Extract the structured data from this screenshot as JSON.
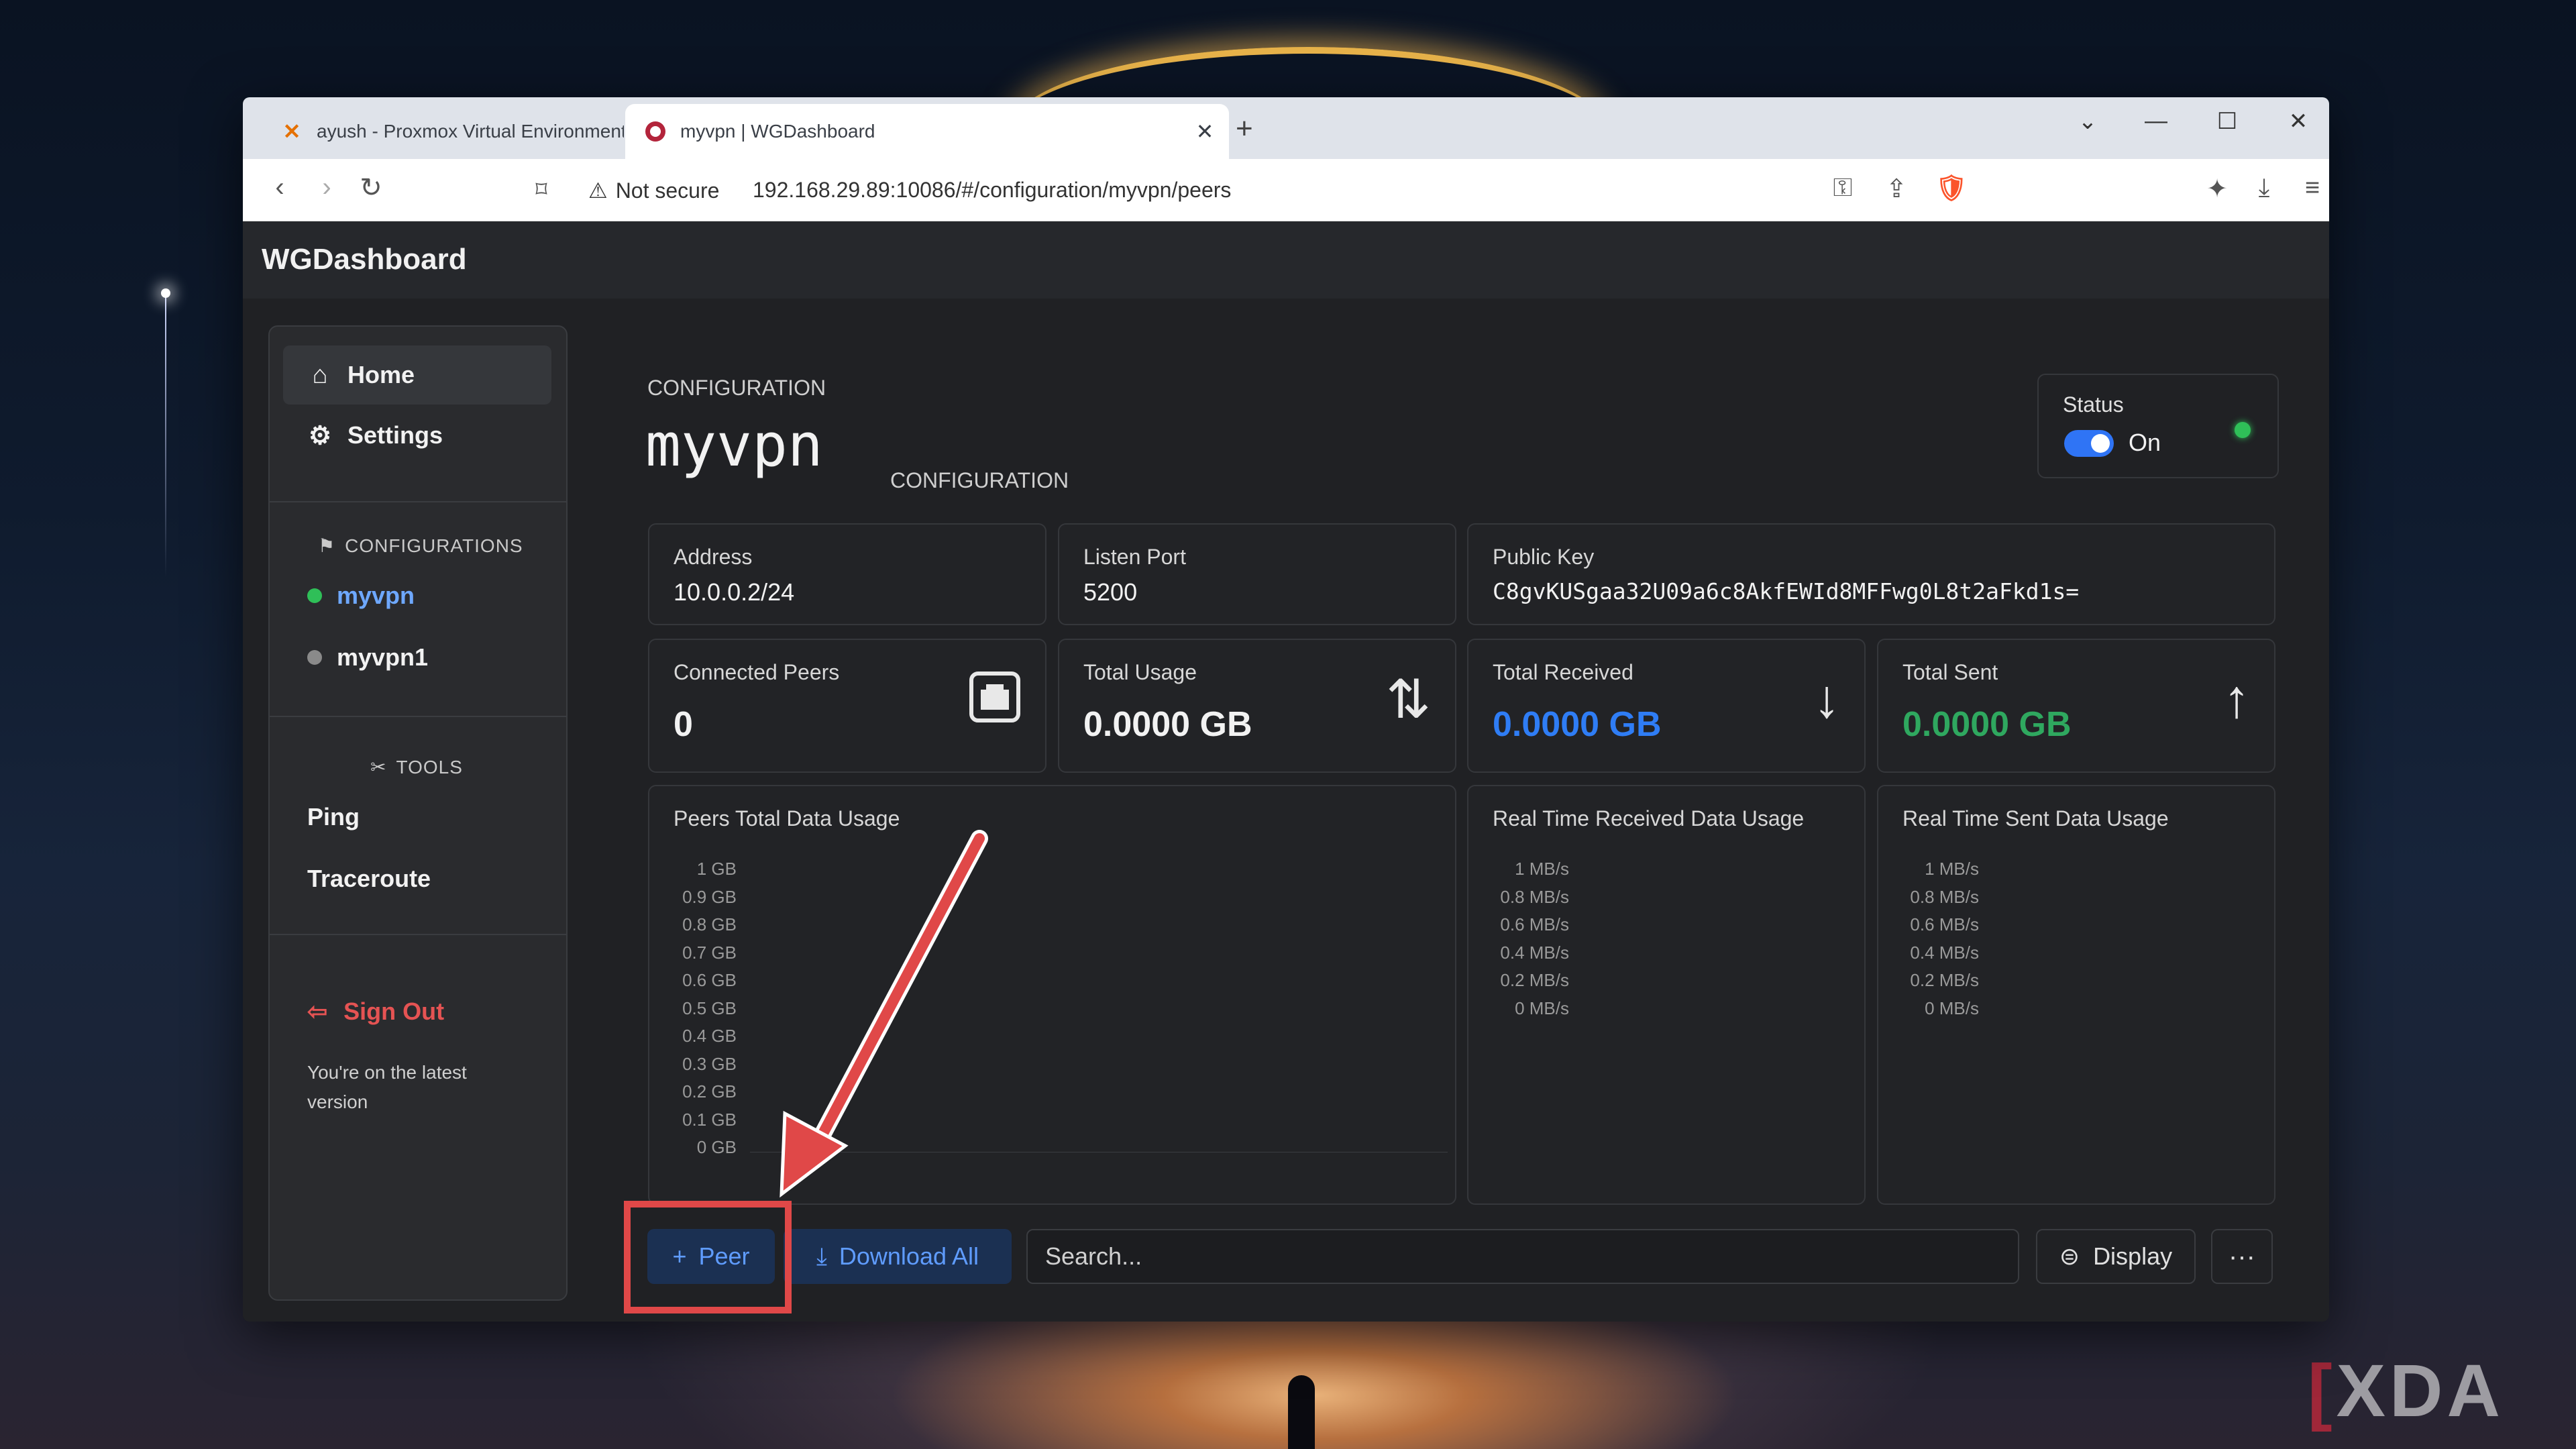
{
  "browser": {
    "tabs": [
      {
        "title": "ayush - Proxmox Virtual Environment",
        "active": false,
        "icon": "proxmox-icon"
      },
      {
        "title": "myvpn | WGDashboard",
        "active": true,
        "icon": "wgdashboard-icon"
      }
    ],
    "security_label": "Not secure",
    "url": "192.168.29.89:10086/#/configuration/myvpn/peers"
  },
  "app": {
    "title": "WGDashboard"
  },
  "sidebar": {
    "nav": [
      {
        "label": "Home",
        "icon": "home-icon"
      },
      {
        "label": "Settings",
        "icon": "gear-icon"
      }
    ],
    "configurations_heading": "CONFIGURATIONS",
    "configurations": [
      {
        "name": "myvpn",
        "status_color": "#2fbf58",
        "active": true
      },
      {
        "name": "myvpn1",
        "status_color": "#8a8a8a",
        "active": false
      }
    ],
    "tools_heading": "TOOLS",
    "tools": [
      "Ping",
      "Traceroute"
    ],
    "sign_out": "Sign Out",
    "version_note": "You're on the latest version"
  },
  "config": {
    "label": "CONFIGURATION",
    "name": "myvpn",
    "status_label": "Status",
    "status_value": "On",
    "address_label": "Address",
    "address": "10.0.0.2/24",
    "listen_port_label": "Listen Port",
    "listen_port": "5200",
    "public_key_label": "Public Key",
    "public_key": "C8gvKUSgaa32U09a6c8AkfEWId8MFFwg0L8t2aFkd1s="
  },
  "stats": {
    "connected_peers_label": "Connected Peers",
    "connected_peers": "0",
    "total_usage_label": "Total Usage",
    "total_usage": "0.0000 GB",
    "total_received_label": "Total Received",
    "total_received": "0.0000 GB",
    "total_sent_label": "Total Sent",
    "total_sent": "0.0000 GB"
  },
  "charts": {
    "peers_usage_title": "Peers Total Data Usage",
    "peers_usage_ticks": [
      "1 GB",
      "0.9 GB",
      "0.8 GB",
      "0.7 GB",
      "0.6 GB",
      "0.5 GB",
      "0.4 GB",
      "0.3 GB",
      "0.2 GB",
      "0.1 GB",
      "0 GB"
    ],
    "received_title": "Real Time Received Data Usage",
    "sent_title": "Real Time Sent Data Usage",
    "rate_ticks": [
      "1 MB/s",
      "0.8 MB/s",
      "0.6 MB/s",
      "0.4 MB/s",
      "0.2 MB/s",
      "0 MB/s"
    ]
  },
  "toolbar": {
    "peer_label": "Peer",
    "download_all_label": "Download All",
    "search_placeholder": "Search...",
    "display_label": "Display",
    "more_label": "···"
  },
  "colors": {
    "accent_blue": "#2f74f5",
    "received_blue": "#2f7df5",
    "sent_green": "#2fa85f",
    "status_green": "#2fbf58",
    "signout_red": "#e55353",
    "annotation_red": "#e04848"
  },
  "watermark": "XDA"
}
